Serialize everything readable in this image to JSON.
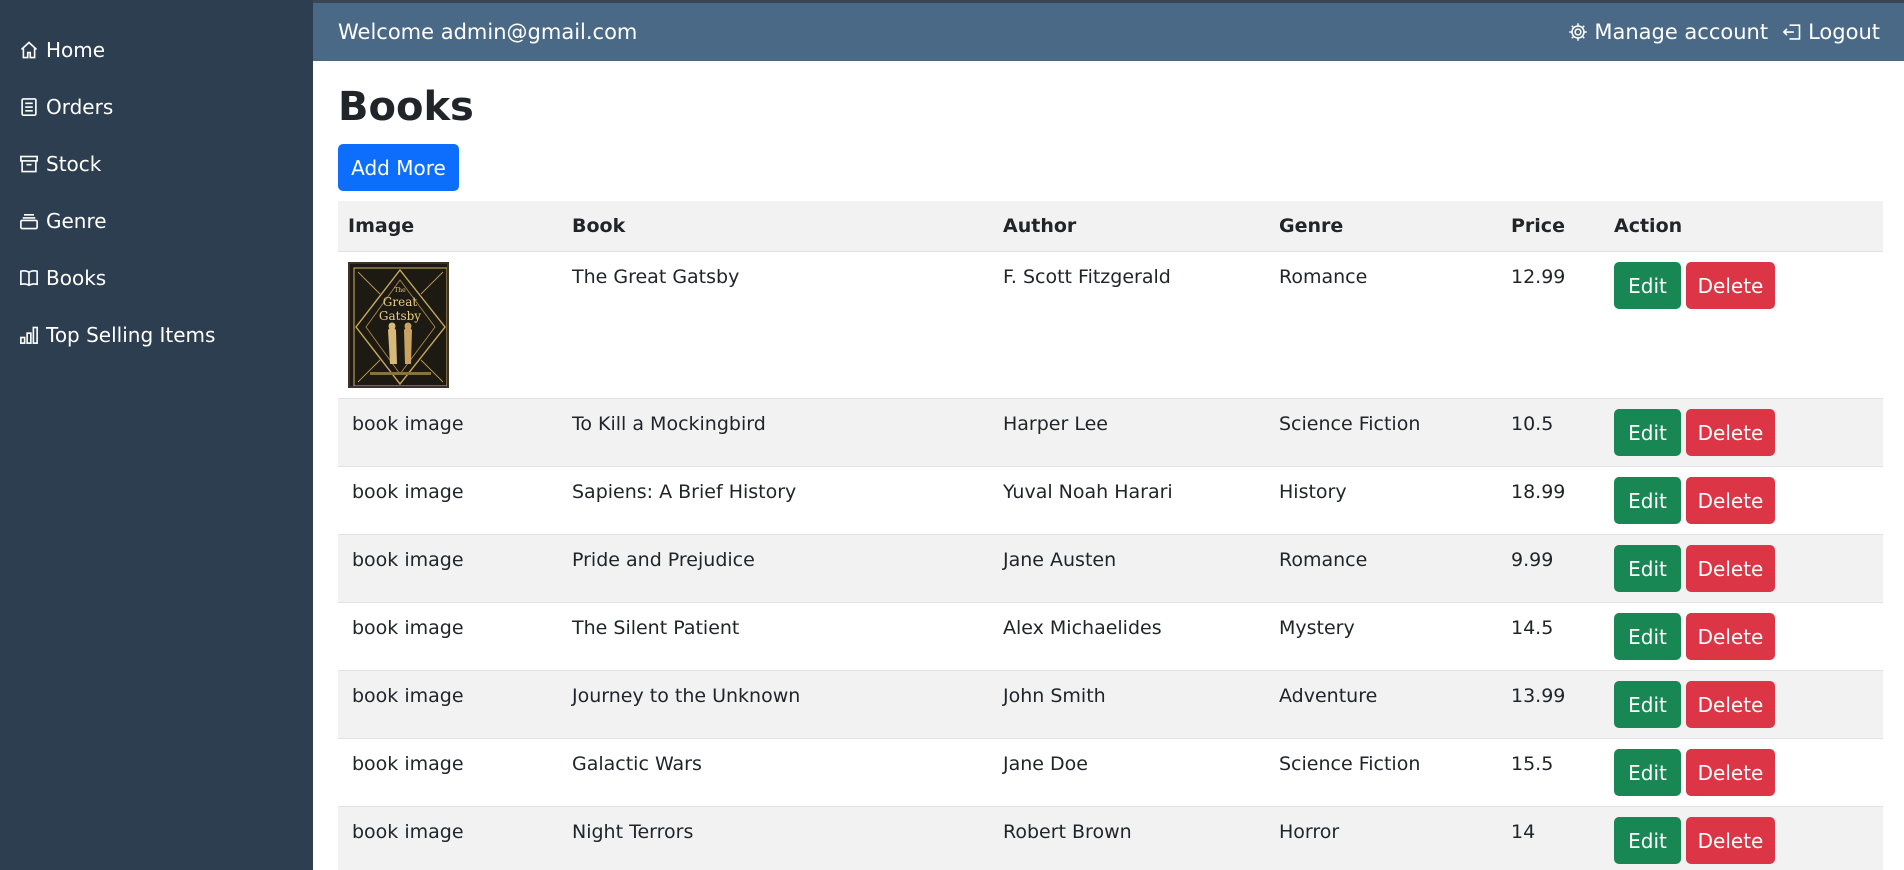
{
  "sidebar": {
    "items": [
      {
        "label": "Home",
        "icon": "house-icon"
      },
      {
        "label": "Orders",
        "icon": "receipt-icon"
      },
      {
        "label": "Stock",
        "icon": "archive-icon"
      },
      {
        "label": "Genre",
        "icon": "collection-icon"
      },
      {
        "label": "Books",
        "icon": "book-icon"
      },
      {
        "label": "Top Selling Items",
        "icon": "bar-chart-icon"
      }
    ]
  },
  "header": {
    "welcome": "Welcome admin@gmail.com",
    "manage_account": "Manage account",
    "logout": "Logout"
  },
  "main": {
    "title": "Books",
    "add_button": "Add More",
    "columns": [
      "Image",
      "Book",
      "Author",
      "Genre",
      "Price",
      "Action"
    ],
    "image_alt": "book image",
    "edit_label": "Edit",
    "delete_label": "Delete",
    "cover_title": "The Great Gatsby",
    "rows": [
      {
        "book": "The Great Gatsby",
        "author": "F. Scott Fitzgerald",
        "genre": "Romance",
        "price": "12.99",
        "has_cover": true
      },
      {
        "book": "To Kill a Mockingbird",
        "author": "Harper Lee",
        "genre": "Science Fiction",
        "price": "10.5",
        "has_cover": false
      },
      {
        "book": "Sapiens: A Brief History",
        "author": "Yuval Noah Harari",
        "genre": "History",
        "price": "18.99",
        "has_cover": false
      },
      {
        "book": "Pride and Prejudice",
        "author": "Jane Austen",
        "genre": "Romance",
        "price": "9.99",
        "has_cover": false
      },
      {
        "book": "The Silent Patient",
        "author": "Alex Michaelides",
        "genre": "Mystery",
        "price": "14.5",
        "has_cover": false
      },
      {
        "book": "Journey to the Unknown",
        "author": "John Smith",
        "genre": "Adventure",
        "price": "13.99",
        "has_cover": false
      },
      {
        "book": "Galactic Wars",
        "author": "Jane Doe",
        "genre": "Science Fiction",
        "price": "15.5",
        "has_cover": false
      },
      {
        "book": "Night Terrors",
        "author": "Robert Brown",
        "genre": "Horror",
        "price": "14",
        "has_cover": false
      }
    ]
  },
  "colors": {
    "sidebar_bg": "#2c3e50",
    "topbar_bg": "#4a6987",
    "primary": "#0d6efd",
    "success": "#198754",
    "danger": "#dc3545"
  }
}
